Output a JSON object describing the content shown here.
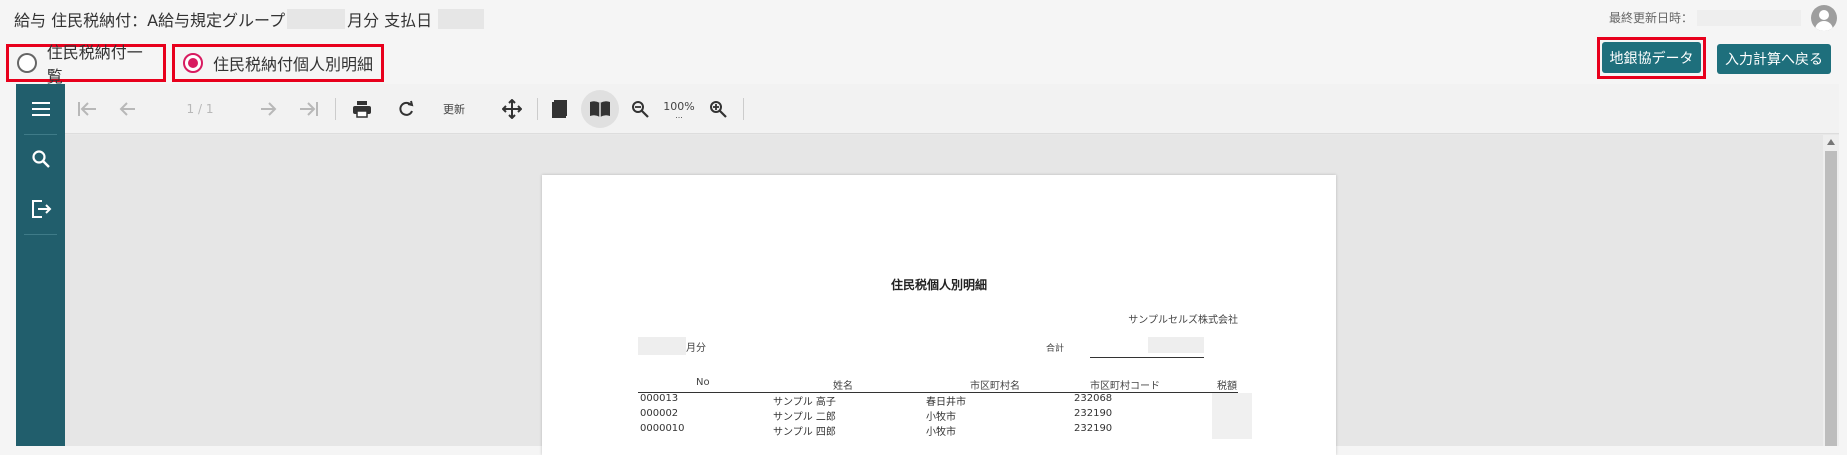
{
  "header": {
    "title_prefix": "給与 住民税納付：A給与規定グループ",
    "title_month": "月分 支払日",
    "last_updated_label": "最終更新日時："
  },
  "radios": [
    {
      "label": "住民税納付一覧",
      "selected": false
    },
    {
      "label": "住民税納付個人別明細",
      "selected": true
    }
  ],
  "buttons": {
    "chigin_data": "地銀協データ",
    "back_to_input": "入力計算へ戻る"
  },
  "toolbar": {
    "page_indicator": "1 / 1",
    "refresh_label": "更新",
    "zoom_level": "100%",
    "zoom_more": "..."
  },
  "report": {
    "title": "住民税個人別明細",
    "company": "サンプルセルズ株式会社",
    "month_suffix": "月分",
    "total_label": "合計",
    "columns": [
      "No",
      "姓名",
      "市区町村名",
      "市区町村コード",
      "税額"
    ],
    "rows": [
      {
        "no": "000013",
        "name": "サンプル 高子",
        "city": "春日井市",
        "code": "232068"
      },
      {
        "no": "000002",
        "name": "サンプル 二郎",
        "city": "小牧市",
        "code": "232190"
      },
      {
        "no": "0000010",
        "name": "サンプル 四郎",
        "city": "小牧市",
        "code": "232190"
      }
    ]
  },
  "colors": {
    "accent": "#1e6f7c",
    "sidenav": "#215e6c",
    "highlight": "#e8001c",
    "radio_selected": "#d81b60"
  }
}
